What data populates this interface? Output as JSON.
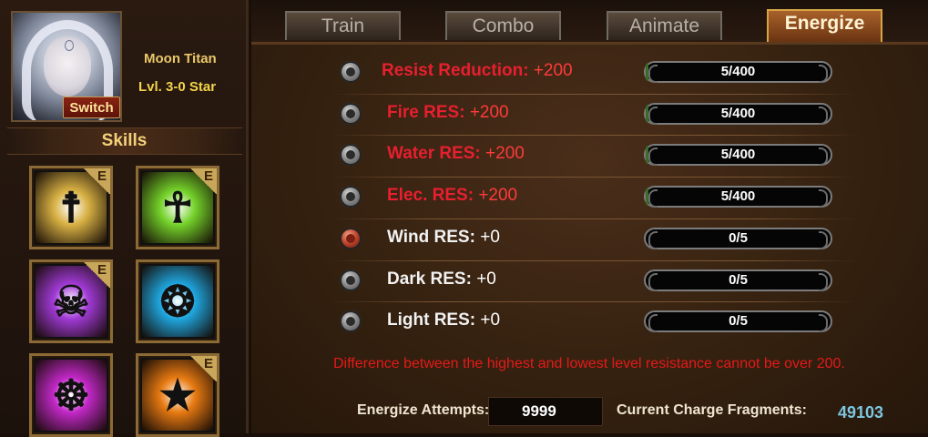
{
  "hero": {
    "name": "Moon Titan",
    "level": "Lvl. 3-0 Star",
    "switch_label": "Switch"
  },
  "skills": {
    "title": "Skills",
    "badge": "E",
    "items": [
      {
        "icon": "rune-skill-icon",
        "color": "#d7b043",
        "badge": true
      },
      {
        "icon": "winged-staff-skill-icon",
        "color": "#74d12a",
        "badge": true
      },
      {
        "icon": "demon-skill-icon",
        "color": "#a13ad6",
        "badge": true
      },
      {
        "icon": "vortex-skill-icon",
        "color": "#1fa7e0",
        "badge": false
      },
      {
        "icon": "skull-skill-icon",
        "color": "#c128c6",
        "badge": false
      },
      {
        "icon": "flame-skill-icon",
        "color": "#e77a12",
        "badge": true
      }
    ]
  },
  "tabs": [
    {
      "label": "Train",
      "active": false
    },
    {
      "label": "Combo",
      "active": false
    },
    {
      "label": "Animate",
      "active": false
    },
    {
      "label": "Energize",
      "active": true
    }
  ],
  "resistances": [
    {
      "name": "Resist Reduction:",
      "value": "+200",
      "progress": "5/400",
      "fraction": 0.0125,
      "maxed": true,
      "selected": false
    },
    {
      "name": "Fire RES:",
      "value": "+200",
      "progress": "5/400",
      "fraction": 0.0125,
      "maxed": true,
      "selected": false
    },
    {
      "name": "Water RES:",
      "value": "+200",
      "progress": "5/400",
      "fraction": 0.0125,
      "maxed": true,
      "selected": false
    },
    {
      "name": "Elec. RES:",
      "value": "+200",
      "progress": "5/400",
      "fraction": 0.0125,
      "maxed": true,
      "selected": false
    },
    {
      "name": "Wind RES:",
      "value": "+0",
      "progress": "0/5",
      "fraction": 0,
      "maxed": false,
      "selected": true
    },
    {
      "name": "Dark RES:",
      "value": "+0",
      "progress": "0/5",
      "fraction": 0,
      "maxed": false,
      "selected": false
    },
    {
      "name": "Light RES:",
      "value": "+0",
      "progress": "0/5",
      "fraction": 0,
      "maxed": false,
      "selected": false
    }
  ],
  "warning": "Difference between the highest and lowest level resistance cannot be over 200.",
  "energize": {
    "attempts_label": "Energize Attempts:",
    "attempts_value": "9999",
    "fragments_label": "Current Charge Fragments:",
    "fragments_value": "49103"
  },
  "colors": {
    "maxed_text": "#e81f2f",
    "normal_text": "#f2f2f2",
    "fragments": "#7cc6e0",
    "active_tab": "#a8612a"
  }
}
